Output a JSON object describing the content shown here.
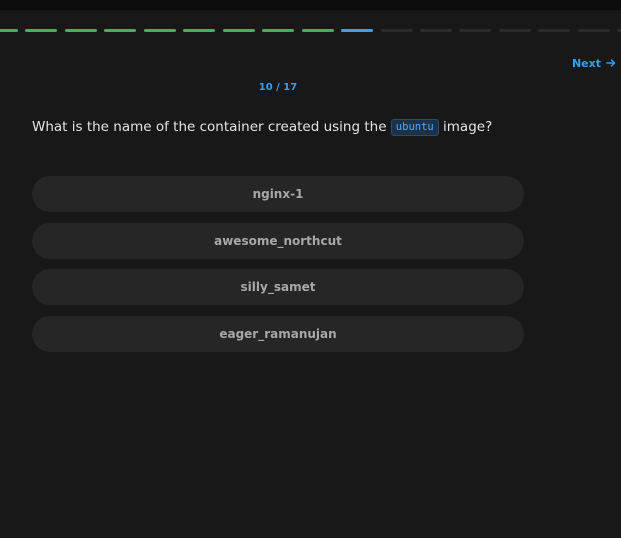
{
  "progress": {
    "total_steps": 17,
    "current_step": 10,
    "completed_steps": 9,
    "colors": {
      "done": "#3bb560",
      "current": "#3a9ef0",
      "pending": "#2b2b2b"
    }
  },
  "nav": {
    "next_label": "Next",
    "next_icon": "arrow-right-icon"
  },
  "quiz": {
    "counter": "10 / 17",
    "question_before": "What is the name of the container created using the",
    "question_code": "ubuntu",
    "question_after": "image?",
    "options": [
      {
        "label": "nginx-1"
      },
      {
        "label": "awesome_northcut"
      },
      {
        "label": "silly_samet"
      },
      {
        "label": "eager_ramanujan"
      }
    ]
  },
  "colors": {
    "background": "#181818",
    "accent": "#3a9ef0",
    "option_bg": "#262626"
  }
}
